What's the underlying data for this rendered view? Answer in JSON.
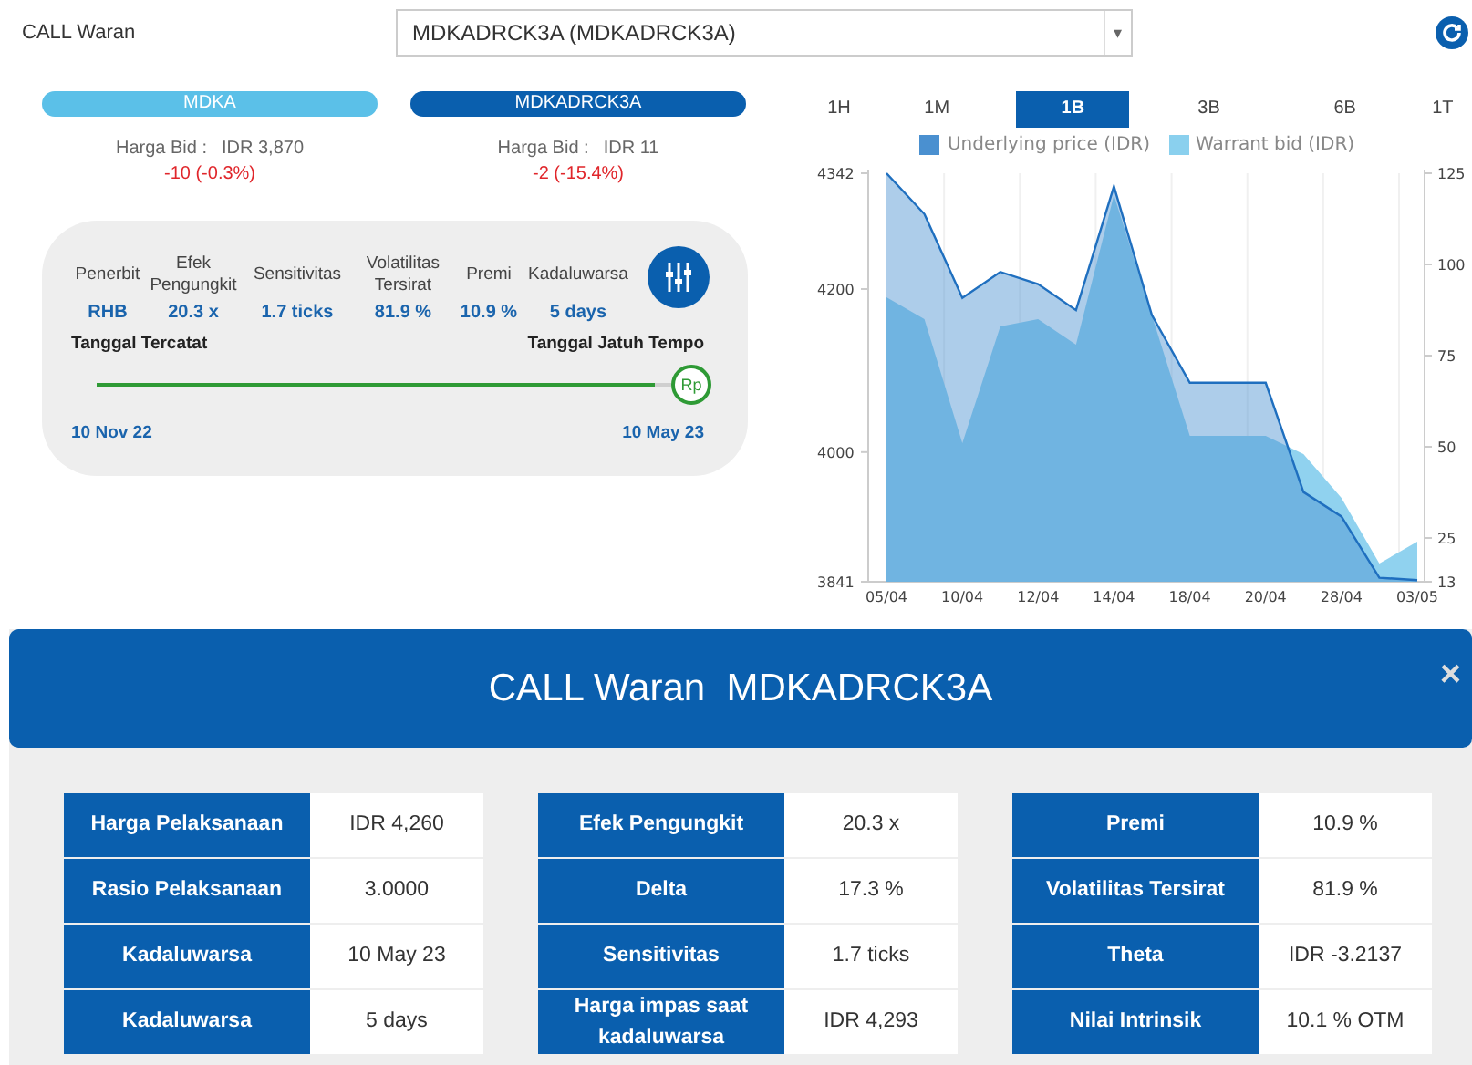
{
  "header": {
    "label": "CALL Waran",
    "dropdown": {
      "value": "MDKADRCK3A (MDKADRCK3A)",
      "arrow": "▾"
    }
  },
  "quotes": [
    {
      "kind": "underlying",
      "name": "MDKA",
      "bid_label": "Harga Bid :",
      "bid": "IDR 3,870",
      "change": "-10 (-0.3%)"
    },
    {
      "kind": "warrant",
      "name": "MDKADRCK3A",
      "bid_label": "Harga Bid :",
      "bid": "IDR 11",
      "change": "-2 (-15.4%)"
    }
  ],
  "summary": {
    "stats": [
      {
        "label": "Penerbit",
        "value": "RHB"
      },
      {
        "label": "Efek Pengungkit",
        "value": "20.3 x"
      },
      {
        "label": "Sensitivitas",
        "value": "1.7 ticks"
      },
      {
        "label": "Volatilitas Tersirat",
        "value": "81.9 %"
      },
      {
        "label": "Premi",
        "value": "10.9 %"
      },
      {
        "label": "Kadaluwarsa",
        "value": "5 days"
      }
    ],
    "listing_label": "Tanggal Tercatat",
    "maturity_label": "Tanggal Jatuh Tempo",
    "marker": "Rp",
    "level": 0.97,
    "listing_date": "10 Nov 22",
    "maturity_date": "10 May 23"
  },
  "periods": [
    {
      "label": "1H",
      "selected": false
    },
    {
      "label": "1M",
      "selected": false
    },
    {
      "label": "1B",
      "selected": true
    },
    {
      "label": "3B",
      "selected": false
    },
    {
      "label": "6B",
      "selected": false
    },
    {
      "label": "1T",
      "selected": false
    }
  ],
  "chart_data": {
    "type": "area",
    "categories": [
      "05/04",
      null,
      "10/04",
      null,
      "12/04",
      null,
      "14/04",
      null,
      "18/04",
      null,
      "20/04",
      null,
      "28/04",
      null,
      "03/05"
    ],
    "ylim": [
      3841,
      4342
    ],
    "yticks": [
      3841,
      4000,
      4200,
      4342
    ],
    "y2lim": [
      13,
      125
    ],
    "y2ticks": [
      13,
      25,
      50,
      75,
      100,
      125
    ],
    "series": [
      {
        "name": "Underlying price (IDR)",
        "color": "#4a90d0",
        "values": [
          4342,
          4292,
          4189,
          4221,
          4206,
          4174,
          4326,
          4168,
          4085,
          4085,
          4085,
          3951,
          3921,
          3846,
          3843
        ]
      },
      {
        "name": "Warrant bid (IDR)",
        "color": "#8ad0ee",
        "axis": "y2",
        "values": [
          91,
          85,
          51,
          83,
          85,
          78,
          119,
          86,
          53,
          53,
          53,
          48,
          36,
          18,
          24
        ]
      }
    ]
  },
  "modal": {
    "title": "CALL Waran  MDKADRCK3A",
    "close": "×",
    "tables": [
      [
        {
          "label": "Harga Pelaksanaan",
          "value": "IDR 4,260"
        },
        {
          "label": "Rasio Pelaksanaan",
          "value": "3.0000"
        },
        {
          "label": "Kadaluwarsa",
          "value": "10 May 23"
        },
        {
          "label": "Kadaluwarsa",
          "value": "5 days"
        }
      ],
      [
        {
          "label": "Efek Pengungkit",
          "value": "20.3 x"
        },
        {
          "label": "Delta",
          "value": "17.3 %"
        },
        {
          "label": "Sensitivitas",
          "value": "1.7 ticks"
        },
        {
          "label": "Harga impas saat kadaluwarsa",
          "value": "IDR 4,293"
        }
      ],
      [
        {
          "label": "Premi",
          "value": "10.9 %"
        },
        {
          "label": "Volatilitas Tersirat",
          "value": "81.9 %"
        },
        {
          "label": "Theta",
          "value": "IDR -3.2137"
        },
        {
          "label": "Nilai Intrinsik",
          "value": "10.1 % OTM"
        }
      ]
    ]
  }
}
